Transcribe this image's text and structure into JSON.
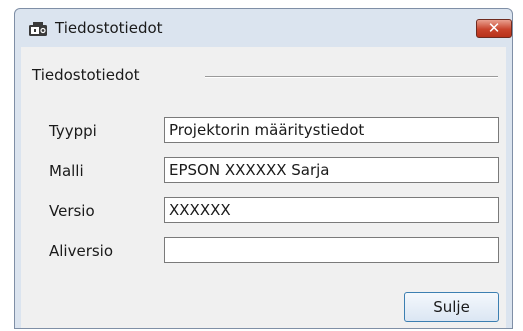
{
  "window": {
    "title": "Tiedostotiedot",
    "app_icon": "projector-icon",
    "close_glyph": "✕"
  },
  "group": {
    "label": "Tiedostotiedot"
  },
  "fields": [
    {
      "label": "Tyyppi",
      "value": "Projektorin määritystiedot"
    },
    {
      "label": "Malli",
      "value": "EPSON XXXXXX Sarja"
    },
    {
      "label": "Versio",
      "value": "XXXXXX"
    },
    {
      "label": "Aliversio",
      "value": ""
    }
  ],
  "buttons": {
    "close_label": "Sulje"
  }
}
